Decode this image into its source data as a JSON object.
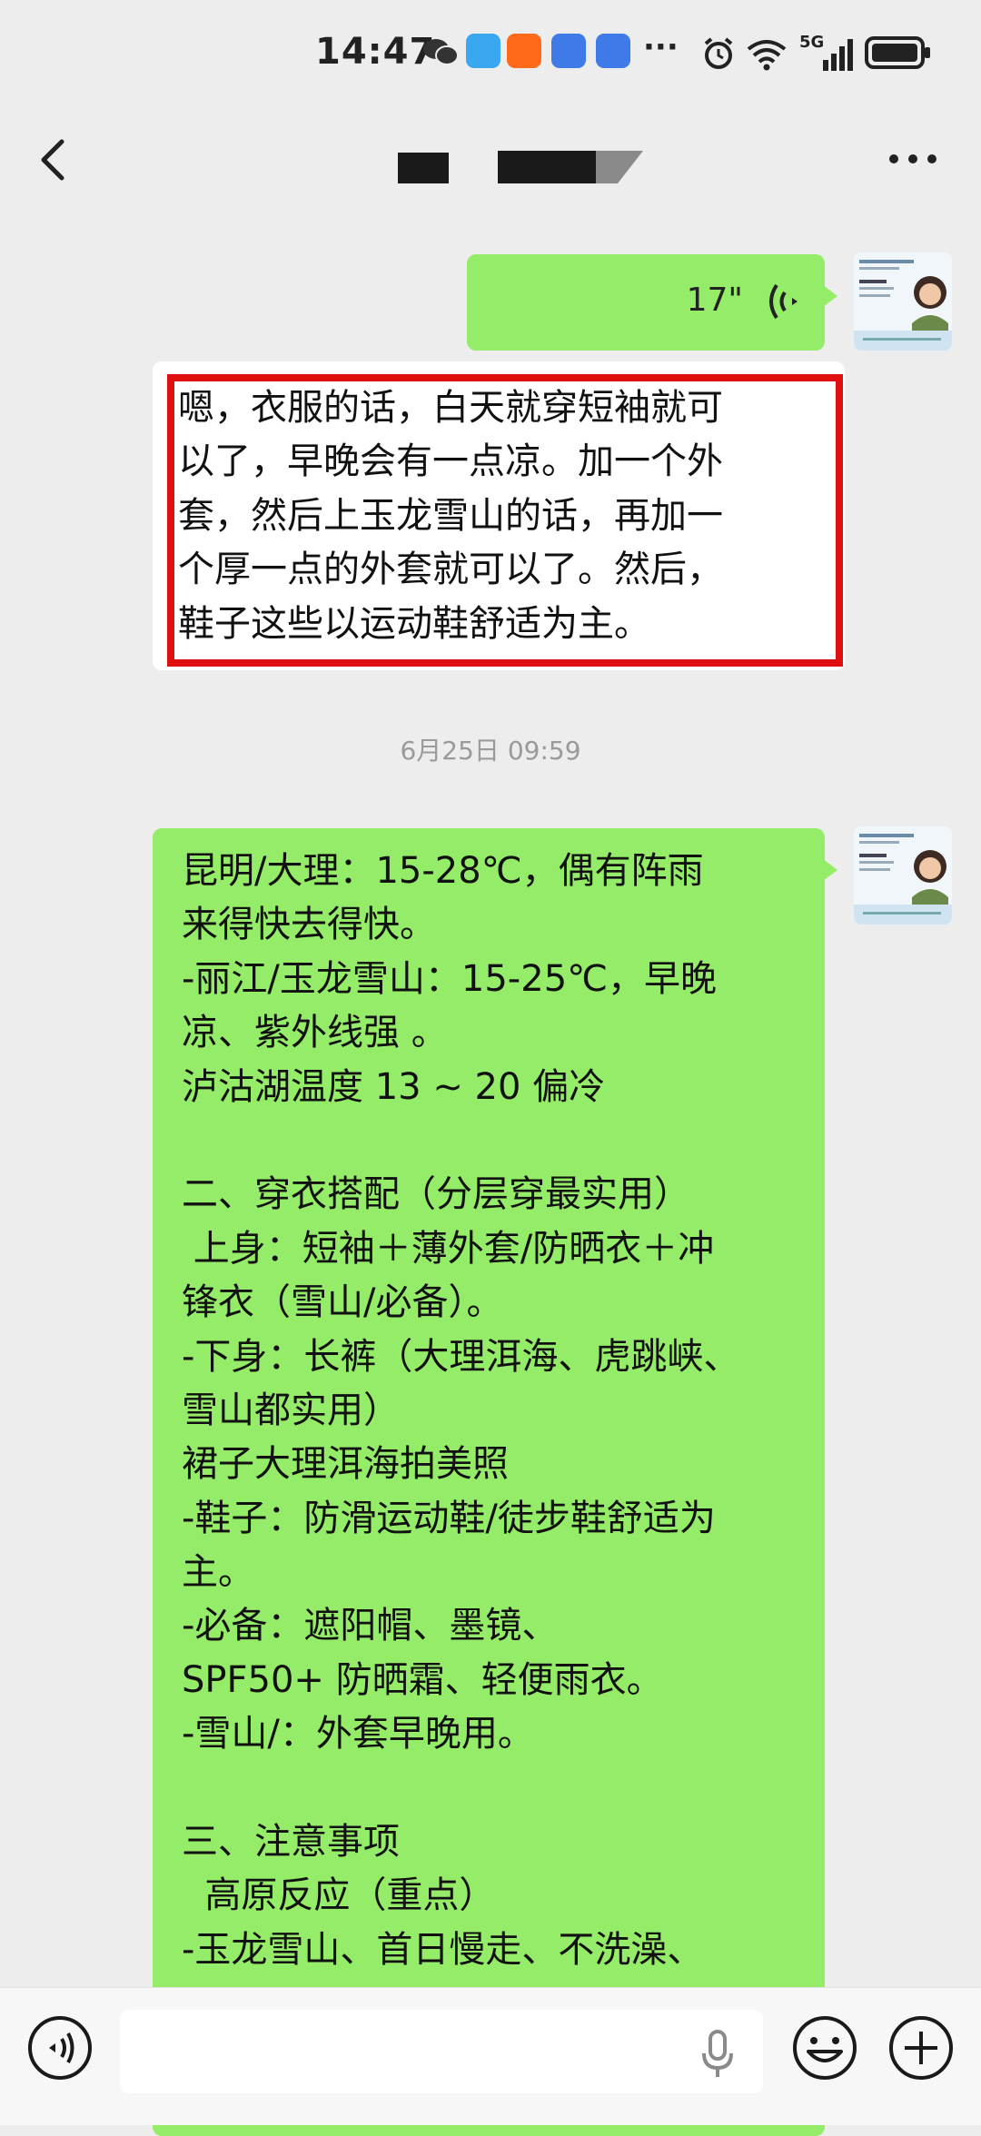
{
  "status_bar": {
    "time": "14:47",
    "network": "5G"
  },
  "chat": {
    "voice_message": {
      "duration": "17\""
    },
    "text_reply": {
      "lines": [
        "嗯，衣服的话，白天就穿短袖就可",
        "以了，早晚会有一点凉。加一个外",
        "套，然后上玉龙雪山的话，再加一",
        "个厚一点的外套就可以了。然后，",
        "鞋子这些以运动鞋舒适为主。"
      ]
    },
    "timestamp": "6月25日 09:59",
    "long_message": {
      "lines": [
        "昆明/大理：15-28℃，偶有阵雨",
        "来得快去得快。",
        "-丽江/玉龙雪山：15-25℃，早晚",
        "凉、紫外线强 。",
        "泸沽湖温度 13 ~ 20 偏冷",
        "",
        "二、穿衣搭配（分层穿最实用）",
        " 上身：短袖＋薄外套/防晒衣＋冲",
        "锋衣（雪山/必备）。",
        "-下身：长裤（大理洱海、虎跳峡、",
        "雪山都实用）",
        "裙子大理洱海拍美照",
        "-鞋子：防滑运动鞋/徒步鞋舒适为",
        "主。",
        "-必备：遮阳帽、墨镜、",
        "SPF50+ 防晒霜、轻便雨衣。",
        "-雪山/：外套早晚用。",
        "",
        "三、注意事项",
        "  高原反应（重点）",
        "-玉龙雪山、首日慢走、不洗澡、"
      ]
    }
  },
  "input_bar": {
    "placeholder": ""
  },
  "colors": {
    "bubble_green": "#95ec69",
    "background": "#ededed",
    "highlight_border": "#e01010"
  },
  "icons": [
    "back-arrow-icon",
    "more-icon",
    "voice-wave-icon",
    "voice-toggle-icon",
    "mic-icon",
    "emoji-icon",
    "plus-icon",
    "alarm-icon",
    "wifi-icon",
    "signal-icon",
    "battery-icon",
    "wechat-icon"
  ]
}
